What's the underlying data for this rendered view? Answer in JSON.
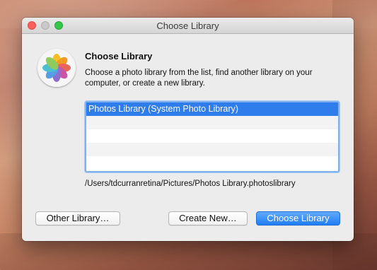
{
  "window": {
    "title": "Choose Library"
  },
  "dialog": {
    "heading": "Choose Library",
    "description": "Choose a photo library from the list, find another library on your computer, or create a new library.",
    "libraries": [
      "Photos Library (System Photo Library)",
      "",
      "",
      "",
      ""
    ],
    "selected_path": "/Users/tdcurranretina/Pictures/Photos Library.photoslibrary"
  },
  "buttons": {
    "other_library": "Other Library…",
    "create_new": "Create New…",
    "choose_library": "Choose Library"
  },
  "colors": {
    "selection": "#2f7ded",
    "primary_button": "#1f7ef5",
    "traffic_close": "#fc605c",
    "traffic_max": "#34c84a"
  },
  "icons": {
    "app": "photos-app-icon"
  }
}
